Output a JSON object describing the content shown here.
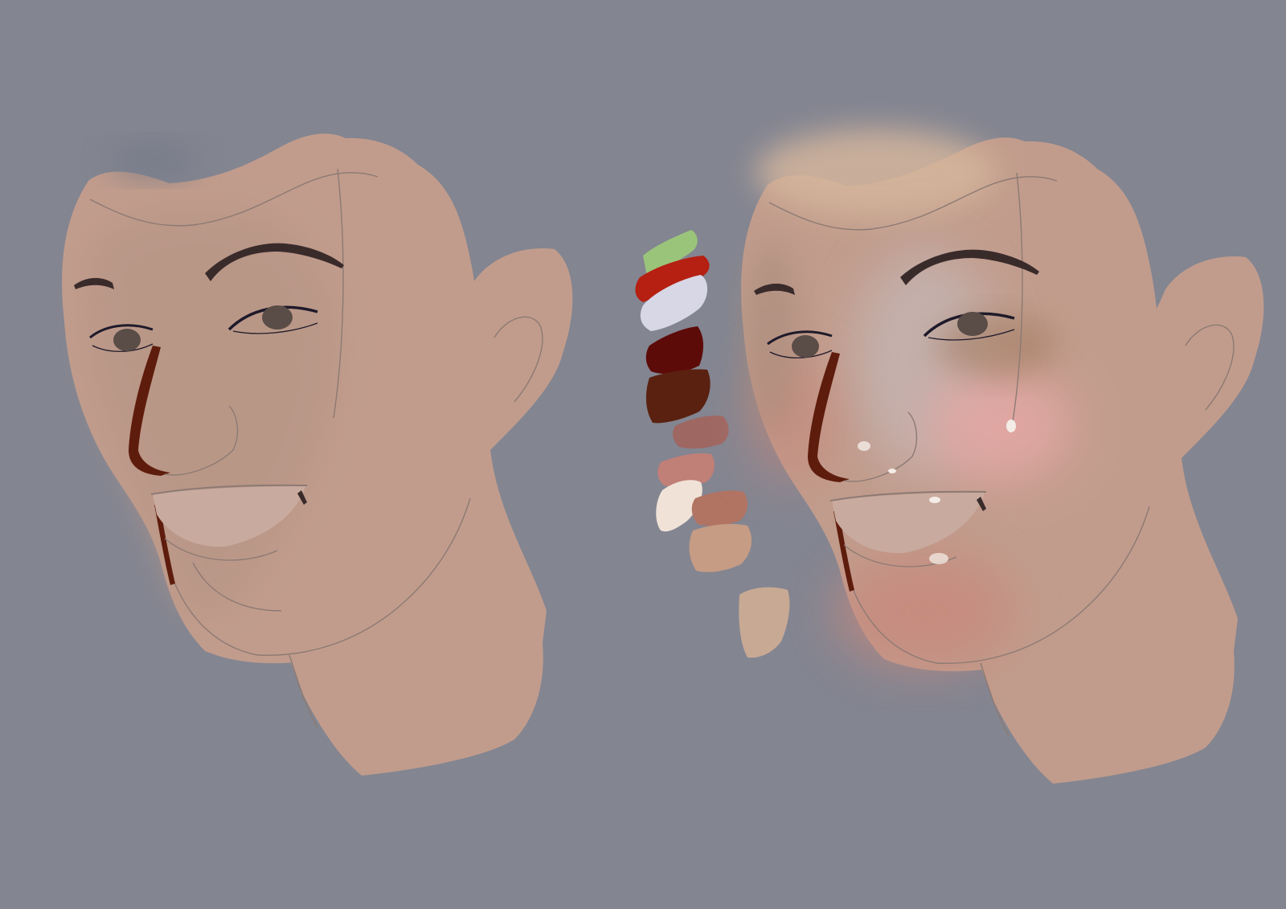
{
  "canvas": {
    "background": "#838591"
  },
  "skin": {
    "base": "#c19c8c",
    "face_shade": "#b79586",
    "sketch_line": "#8c7a73",
    "brow": "#3a2b2b",
    "eye": "#5a4c47",
    "eyeliner": "#1e1a2a",
    "nasolabial_shadow": "#5e1c0c",
    "teeth": "#c8aa9e"
  },
  "painted_face": {
    "forehead_light": "#d5b69c",
    "cheek_blush": "#e3a7a4",
    "highlight": "#f4ece6",
    "lower_face_warm": "#c8877c",
    "cool_plane": "#c6bfc4"
  },
  "palette_swatches": [
    {
      "name": "green",
      "color": "#9bc47b"
    },
    {
      "name": "red",
      "color": "#b52013"
    },
    {
      "name": "lavender",
      "color": "#d8d7e6"
    },
    {
      "name": "deep-maroon",
      "color": "#5d0b09"
    },
    {
      "name": "dark-brown",
      "color": "#5a2110"
    },
    {
      "name": "dusty-rose",
      "color": "#9e6762"
    },
    {
      "name": "coral-pink",
      "color": "#c07f77"
    },
    {
      "name": "cream",
      "color": "#f0e2d6"
    },
    {
      "name": "terracotta",
      "color": "#b17362"
    },
    {
      "name": "tan",
      "color": "#c69c84"
    },
    {
      "name": "beige",
      "color": "#c8a994"
    }
  ]
}
